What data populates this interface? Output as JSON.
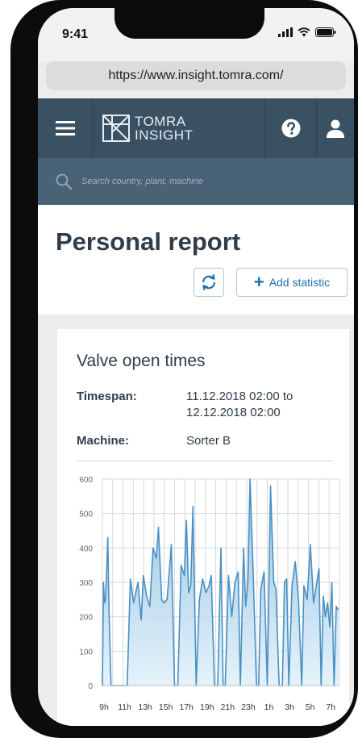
{
  "status": {
    "time": "9:41"
  },
  "browser": {
    "url": "https://www.insight.tomra.com/"
  },
  "header": {
    "logo_line1": "TOMRA",
    "logo_line2": "INSIGHT"
  },
  "search": {
    "placeholder": "Search country, plant, machine"
  },
  "page": {
    "title": "Personal report",
    "add_statistic_label": "Add statistic"
  },
  "card": {
    "title": "Valve open times",
    "timespan_label": "Timespan:",
    "timespan_value": "11.12.2018 02:00 to 12.12.2018 02:00",
    "machine_label": "Machine:",
    "machine_value": "Sorter B"
  },
  "colors": {
    "header": "#3a5163",
    "search": "#4a6275",
    "accent": "#1e6fb0",
    "series": "#4a90c2"
  },
  "chart_data": {
    "type": "area",
    "yticks": [
      0,
      100,
      200,
      300,
      400,
      500,
      600
    ],
    "ylim": [
      0,
      600
    ],
    "xlim": [
      9,
      31
    ],
    "xtick_labels": [
      "9h",
      "11h",
      "13h",
      "15h",
      "17h",
      "19h",
      "21h",
      "23h",
      "1h",
      "3h",
      "5h",
      "7h"
    ],
    "grid": true,
    "x": [
      9.0,
      9.1,
      9.2,
      9.3,
      9.5,
      9.6,
      9.8,
      10.1,
      10.4,
      10.8,
      11.3,
      11.6,
      11.9,
      12.3,
      12.6,
      12.8,
      13.1,
      13.4,
      13.7,
      14.0,
      14.2,
      14.5,
      14.7,
      15.0,
      15.4,
      15.7,
      16.0,
      16.3,
      16.6,
      16.8,
      17.0,
      17.2,
      17.4,
      17.7,
      18.0,
      18.3,
      18.6,
      18.9,
      19.1,
      19.4,
      19.7,
      20.0,
      20.2,
      20.4,
      20.7,
      21.0,
      21.3,
      21.6,
      21.8,
      22.1,
      22.3,
      22.5,
      22.7,
      23.0,
      23.3,
      23.5,
      23.7,
      24.0,
      24.3,
      24.6,
      24.9,
      25.1,
      25.4,
      25.7,
      25.9,
      26.1,
      26.3,
      26.6,
      26.9,
      27.2,
      27.5,
      27.7,
      28.0,
      28.3,
      28.6,
      28.9,
      29.1,
      29.3,
      29.5,
      29.7,
      29.9,
      30.1,
      30.3,
      30.5,
      30.7,
      30.9
    ],
    "y": [
      0,
      300,
      240,
      250,
      430,
      240,
      0,
      0,
      0,
      0,
      0,
      310,
      240,
      300,
      190,
      320,
      260,
      230,
      400,
      370,
      460,
      250,
      240,
      250,
      410,
      0,
      0,
      350,
      320,
      480,
      270,
      290,
      520,
      0,
      250,
      310,
      270,
      290,
      320,
      0,
      0,
      400,
      0,
      0,
      320,
      200,
      300,
      330,
      0,
      400,
      230,
      300,
      600,
      320,
      0,
      0,
      280,
      330,
      0,
      580,
      300,
      280,
      0,
      0,
      300,
      310,
      0,
      290,
      360,
      250,
      0,
      290,
      250,
      410,
      240,
      300,
      340,
      0,
      260,
      200,
      240,
      170,
      300,
      0,
      230,
      220
    ],
    "series": [
      {
        "values_ref": "y"
      }
    ]
  }
}
